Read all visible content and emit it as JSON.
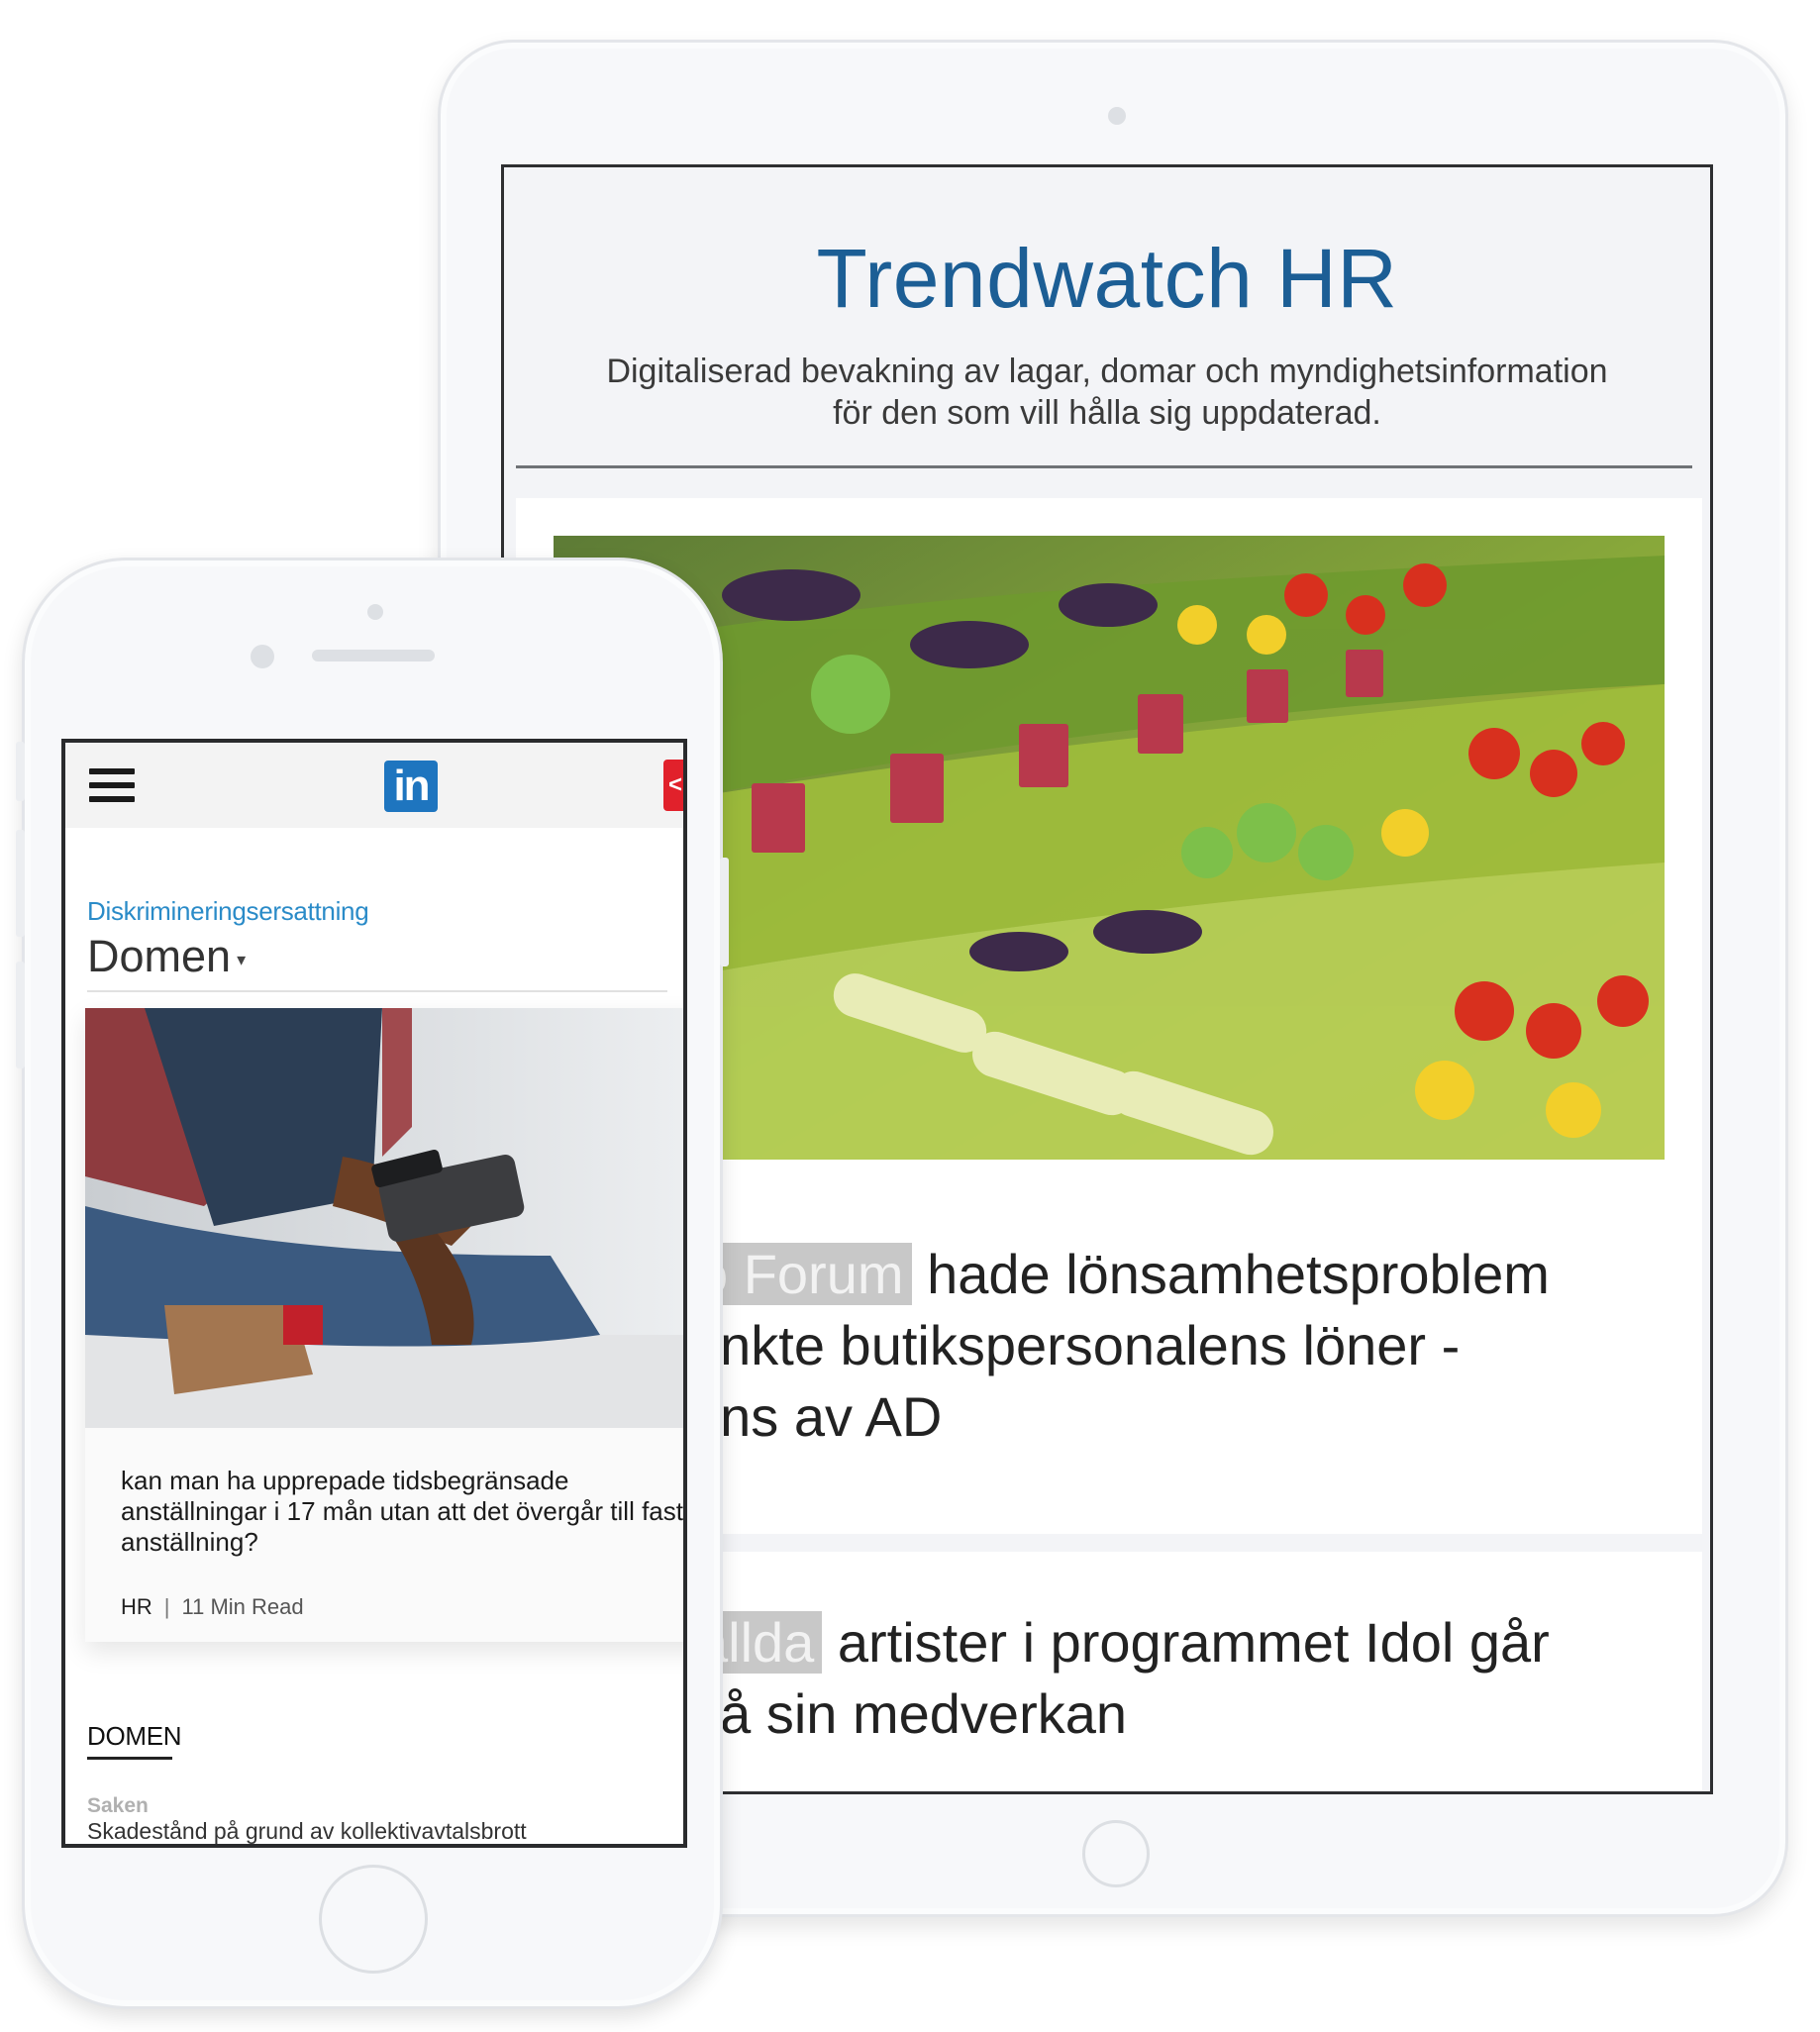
{
  "tablet": {
    "title": "Trendwatch HR",
    "subtitle_line1": "Digitaliserad bevakning av lagar, domar och myndighetsinformation",
    "subtitle_line2": "för den som vill hålla sig uppdaterad.",
    "article1": {
      "tag": "o Forum",
      "line1": "hade lönsamhetsproblem",
      "line2": "ankte butikspersonalens löner -",
      "line3": "nns av AD"
    },
    "article2": {
      "tag": "ällda",
      "line1": "artister i programmet Idol går",
      "line2": "på sin medverkan"
    }
  },
  "phone": {
    "logo_text": "in",
    "red_tab_glyph": "<",
    "breadcrumb": "Diskrimineringsersattning",
    "dropdown_label": "Domen",
    "dropdown_caret": "▾",
    "card": {
      "title": "kan man ha upprepade tidsbegränsade anställningar i 17 mån utan att det övergår till fast anställning?",
      "category": "HR",
      "separator": "|",
      "read_time": "11 Min Read"
    },
    "section_heading": "DOMEN",
    "item_label": "Saken",
    "item_text": "Skadestånd på grund av kollektivavtalsbrott"
  },
  "colors": {
    "title_blue": "#1c5e95",
    "link_blue": "#2a8bc8",
    "linkedin_blue": "#1e75bf",
    "alert_red": "#e1212b"
  }
}
